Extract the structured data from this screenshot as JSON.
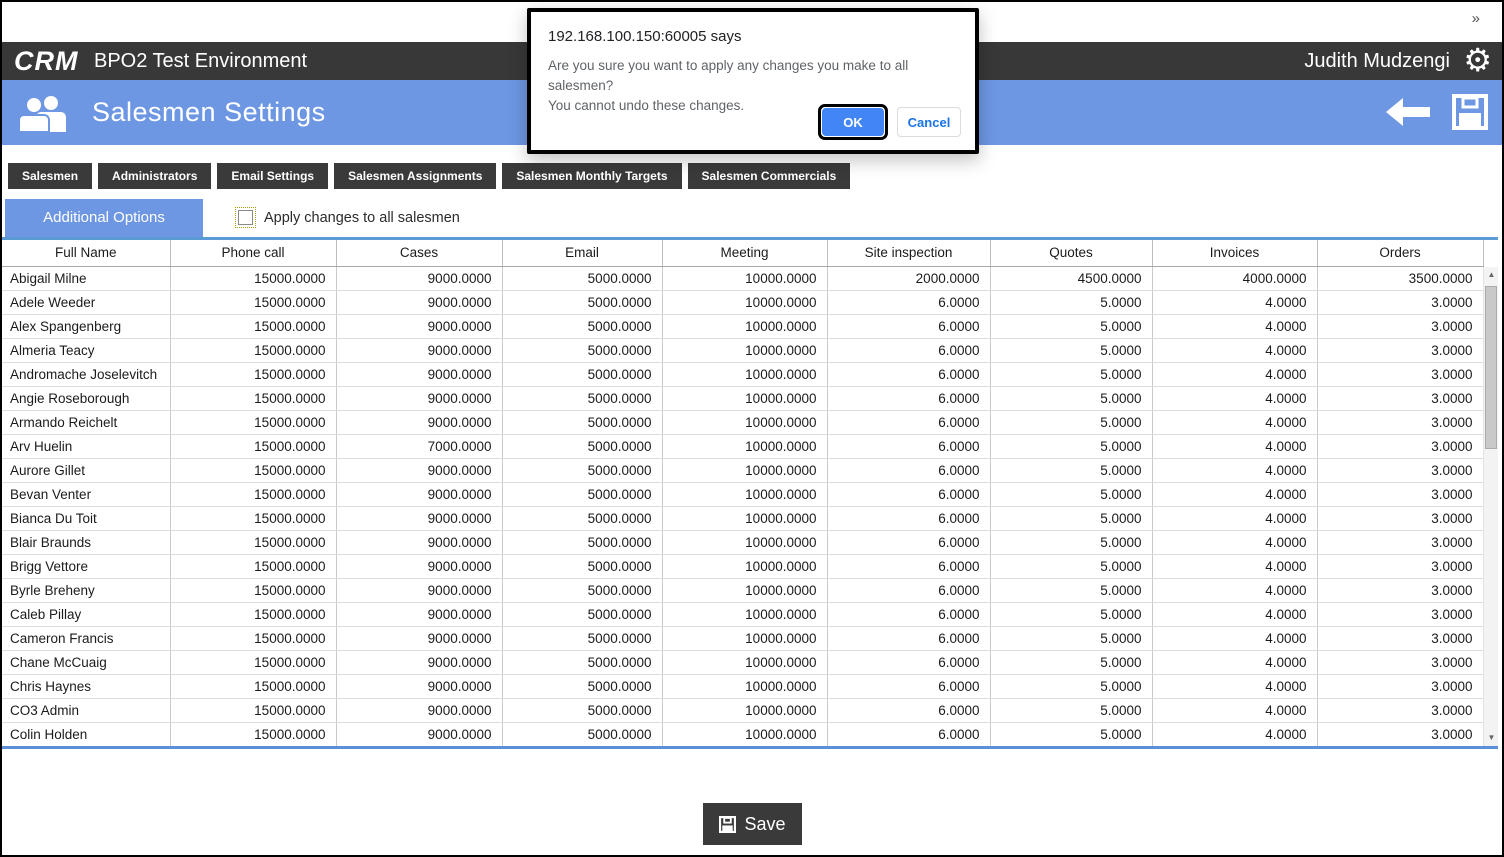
{
  "chrome": {
    "overflow_chevron": "»"
  },
  "app_header": {
    "logo": "CRM",
    "title": "BPO2 Test Environment",
    "user": "Judith Mudzengi"
  },
  "page_header": {
    "title": "Salesmen Settings"
  },
  "tabs": [
    "Salesmen",
    "Administrators",
    "Email Settings",
    "Salesmen Assignments",
    "Salesmen Monthly Targets",
    "Salesmen Commercials"
  ],
  "options": {
    "tab": "Additional Options",
    "checkbox_label": "Apply changes to all salesmen",
    "checkbox_checked": false
  },
  "table": {
    "columns": [
      "Full Name",
      "Phone call",
      "Cases",
      "Email",
      "Meeting",
      "Site inspection",
      "Quotes",
      "Invoices",
      "Orders"
    ],
    "rows": [
      [
        "Abigail Milne",
        "15000.0000",
        "9000.0000",
        "5000.0000",
        "10000.0000",
        "2000.0000",
        "4500.0000",
        "4000.0000",
        "3500.0000"
      ],
      [
        "Adele Weeder",
        "15000.0000",
        "9000.0000",
        "5000.0000",
        "10000.0000",
        "6.0000",
        "5.0000",
        "4.0000",
        "3.0000"
      ],
      [
        "Alex Spangenberg",
        "15000.0000",
        "9000.0000",
        "5000.0000",
        "10000.0000",
        "6.0000",
        "5.0000",
        "4.0000",
        "3.0000"
      ],
      [
        "Almeria Teacy",
        "15000.0000",
        "9000.0000",
        "5000.0000",
        "10000.0000",
        "6.0000",
        "5.0000",
        "4.0000",
        "3.0000"
      ],
      [
        "Andromache Joselevitch",
        "15000.0000",
        "9000.0000",
        "5000.0000",
        "10000.0000",
        "6.0000",
        "5.0000",
        "4.0000",
        "3.0000"
      ],
      [
        "Angie Roseborough",
        "15000.0000",
        "9000.0000",
        "5000.0000",
        "10000.0000",
        "6.0000",
        "5.0000",
        "4.0000",
        "3.0000"
      ],
      [
        "Armando Reichelt",
        "15000.0000",
        "9000.0000",
        "5000.0000",
        "10000.0000",
        "6.0000",
        "5.0000",
        "4.0000",
        "3.0000"
      ],
      [
        "Arv Huelin",
        "15000.0000",
        "7000.0000",
        "5000.0000",
        "10000.0000",
        "6.0000",
        "5.0000",
        "4.0000",
        "3.0000"
      ],
      [
        "Aurore Gillet",
        "15000.0000",
        "9000.0000",
        "5000.0000",
        "10000.0000",
        "6.0000",
        "5.0000",
        "4.0000",
        "3.0000"
      ],
      [
        "Bevan Venter",
        "15000.0000",
        "9000.0000",
        "5000.0000",
        "10000.0000",
        "6.0000",
        "5.0000",
        "4.0000",
        "3.0000"
      ],
      [
        "Bianca Du Toit",
        "15000.0000",
        "9000.0000",
        "5000.0000",
        "10000.0000",
        "6.0000",
        "5.0000",
        "4.0000",
        "3.0000"
      ],
      [
        "Blair Braunds",
        "15000.0000",
        "9000.0000",
        "5000.0000",
        "10000.0000",
        "6.0000",
        "5.0000",
        "4.0000",
        "3.0000"
      ],
      [
        "Brigg Vettore",
        "15000.0000",
        "9000.0000",
        "5000.0000",
        "10000.0000",
        "6.0000",
        "5.0000",
        "4.0000",
        "3.0000"
      ],
      [
        "Byrle Breheny",
        "15000.0000",
        "9000.0000",
        "5000.0000",
        "10000.0000",
        "6.0000",
        "5.0000",
        "4.0000",
        "3.0000"
      ],
      [
        "Caleb Pillay",
        "15000.0000",
        "9000.0000",
        "5000.0000",
        "10000.0000",
        "6.0000",
        "5.0000",
        "4.0000",
        "3.0000"
      ],
      [
        "Cameron Francis",
        "15000.0000",
        "9000.0000",
        "5000.0000",
        "10000.0000",
        "6.0000",
        "5.0000",
        "4.0000",
        "3.0000"
      ],
      [
        "Chane McCuaig",
        "15000.0000",
        "9000.0000",
        "5000.0000",
        "10000.0000",
        "6.0000",
        "5.0000",
        "4.0000",
        "3.0000"
      ],
      [
        "Chris Haynes",
        "15000.0000",
        "9000.0000",
        "5000.0000",
        "10000.0000",
        "6.0000",
        "5.0000",
        "4.0000",
        "3.0000"
      ],
      [
        "CO3 Admin",
        "15000.0000",
        "9000.0000",
        "5000.0000",
        "10000.0000",
        "6.0000",
        "5.0000",
        "4.0000",
        "3.0000"
      ],
      [
        "Colin Holden",
        "15000.0000",
        "9000.0000",
        "5000.0000",
        "10000.0000",
        "6.0000",
        "5.0000",
        "4.0000",
        "3.0000"
      ]
    ]
  },
  "footer": {
    "save": "Save"
  },
  "dialog": {
    "title": "192.168.100.150:60005 says",
    "line1": "Are you sure you want to apply any changes you make to all salesmen?",
    "line2": "You cannot undo these changes.",
    "ok": "OK",
    "cancel": "Cancel"
  },
  "icons": {
    "gear": "⚙",
    "scroll_up": "▲",
    "scroll_down": "▼"
  },
  "colors": {
    "accent_blue": "#6d97e3",
    "charcoal": "#3a3a3a",
    "appbar_dark": "#383838",
    "table_rule_blue": "#5b9bd5",
    "ok_button_blue": "#4285f4",
    "cancel_text_blue": "#1a73e8"
  }
}
